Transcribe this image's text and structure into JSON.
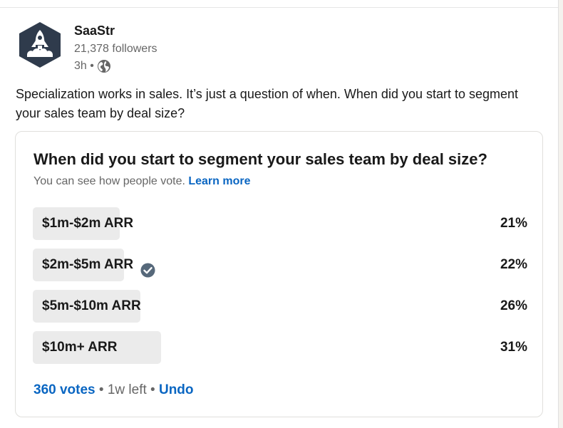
{
  "author": {
    "name": "SaaStr",
    "followers": "21,378 followers",
    "time": "3h •",
    "avatar_icon": "rocket-logo-icon",
    "visibility_icon": "globe-icon"
  },
  "post": {
    "text": "Specialization works in sales. It’s just a question of when. When did you start to segment your sales team by deal size?"
  },
  "poll": {
    "question": "When did you start to segment your sales team by deal size?",
    "notice": "You can see how people vote.",
    "learn_more": "Learn more",
    "options": [
      {
        "label": "$1m-$2m ARR",
        "percent": "21%",
        "share": 0.21,
        "selected": false
      },
      {
        "label": "$2m-$5m ARR",
        "percent": "22%",
        "share": 0.22,
        "selected": true
      },
      {
        "label": "$5m-$10m ARR",
        "percent": "26%",
        "share": 0.26,
        "selected": false
      },
      {
        "label": "$10m+ ARR",
        "percent": "31%",
        "share": 0.31,
        "selected": false
      }
    ],
    "votes": "360 votes",
    "time_left": "• 1w left •",
    "undo": "Undo"
  },
  "colors": {
    "link": "#0a66c2",
    "bar_fill": "#ebebeb",
    "logo_dark": "#2f3b4c",
    "check": "#56687a"
  }
}
